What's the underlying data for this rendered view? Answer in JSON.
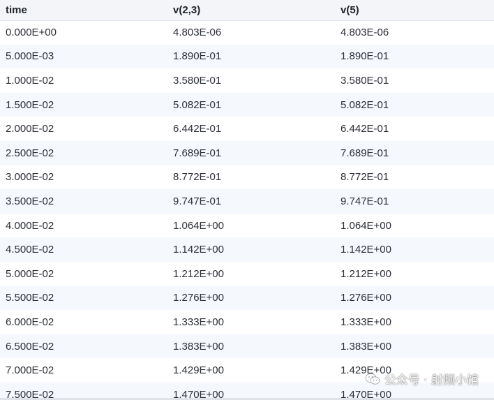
{
  "columns": [
    "time",
    "v(2,3)",
    "v(5)"
  ],
  "rows": [
    [
      "0.000E+00",
      "4.803E-06",
      "4.803E-06"
    ],
    [
      "5.000E-03",
      "1.890E-01",
      "1.890E-01"
    ],
    [
      "1.000E-02",
      "3.580E-01",
      "3.580E-01"
    ],
    [
      "1.500E-02",
      "5.082E-01",
      "5.082E-01"
    ],
    [
      "2.000E-02",
      "6.442E-01",
      "6.442E-01"
    ],
    [
      "2.500E-02",
      "7.689E-01",
      "7.689E-01"
    ],
    [
      "3.000E-02",
      "8.772E-01",
      "8.772E-01"
    ],
    [
      "3.500E-02",
      "9.747E-01",
      "9.747E-01"
    ],
    [
      "4.000E-02",
      "1.064E+00",
      "1.064E+00"
    ],
    [
      "4.500E-02",
      "1.142E+00",
      "1.142E+00"
    ],
    [
      "5.000E-02",
      "1.212E+00",
      "1.212E+00"
    ],
    [
      "5.500E-02",
      "1.276E+00",
      "1.276E+00"
    ],
    [
      "6.000E-02",
      "1.333E+00",
      "1.333E+00"
    ],
    [
      "6.500E-02",
      "1.383E+00",
      "1.383E+00"
    ],
    [
      "7.000E-02",
      "1.429E+00",
      "1.429E+00"
    ],
    [
      "7.500E-02",
      "1.470E+00",
      "1.470E+00"
    ]
  ],
  "watermark": {
    "text": "公众号 · 射频小馆",
    "icon": "wechat-icon"
  }
}
